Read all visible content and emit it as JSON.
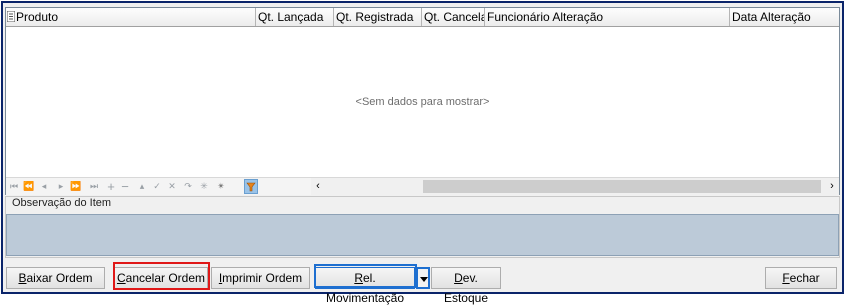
{
  "grid": {
    "columns": [
      {
        "label": "Produto"
      },
      {
        "label": "Qt. Lançada"
      },
      {
        "label": "Qt. Registrada"
      },
      {
        "label": "Qt. Cancelad"
      },
      {
        "label": "Funcionário Alteração"
      },
      {
        "label": "Data Alteração"
      }
    ],
    "empty_text": "<Sem dados para mostrar>",
    "nav_icons": [
      "first-icon",
      "prev-page-icon",
      "prev-icon",
      "next-icon",
      "next-page-icon",
      "last-icon",
      "add-icon",
      "remove-icon",
      "up-icon",
      "check-icon",
      "cancel-icon",
      "refresh-icon",
      "asterisk-icon",
      "bookmark-icon",
      "filter-icon"
    ]
  },
  "observation": {
    "label": "Observação do Item",
    "value": ""
  },
  "buttons": {
    "baixar": {
      "label": "Baixar Ordem",
      "mnemonic": "B",
      "rest": "aixar Ordem"
    },
    "cancelar": {
      "label": "Cancelar Ordem",
      "mnemonic": "C",
      "rest": "ancelar Ordem"
    },
    "imprimir": {
      "label": "Imprimir Ordem",
      "mnemonic": "I",
      "rest": "mprimir Ordem"
    },
    "rel_mov": {
      "label": "Rel. Movimentação",
      "mnemonic": "R",
      "rest": "el. Movimentação"
    },
    "dev_estoque": {
      "label": "Dev. Estoque",
      "mnemonic": "D",
      "rest": "ev. Estoque"
    },
    "fechar": {
      "label": "Fechar",
      "mnemonic": "F",
      "rest": "echar"
    }
  },
  "colors": {
    "highlight_red": "#e01818",
    "highlight_blue": "#1e6fd0",
    "observation_bg": "#bccad8"
  }
}
